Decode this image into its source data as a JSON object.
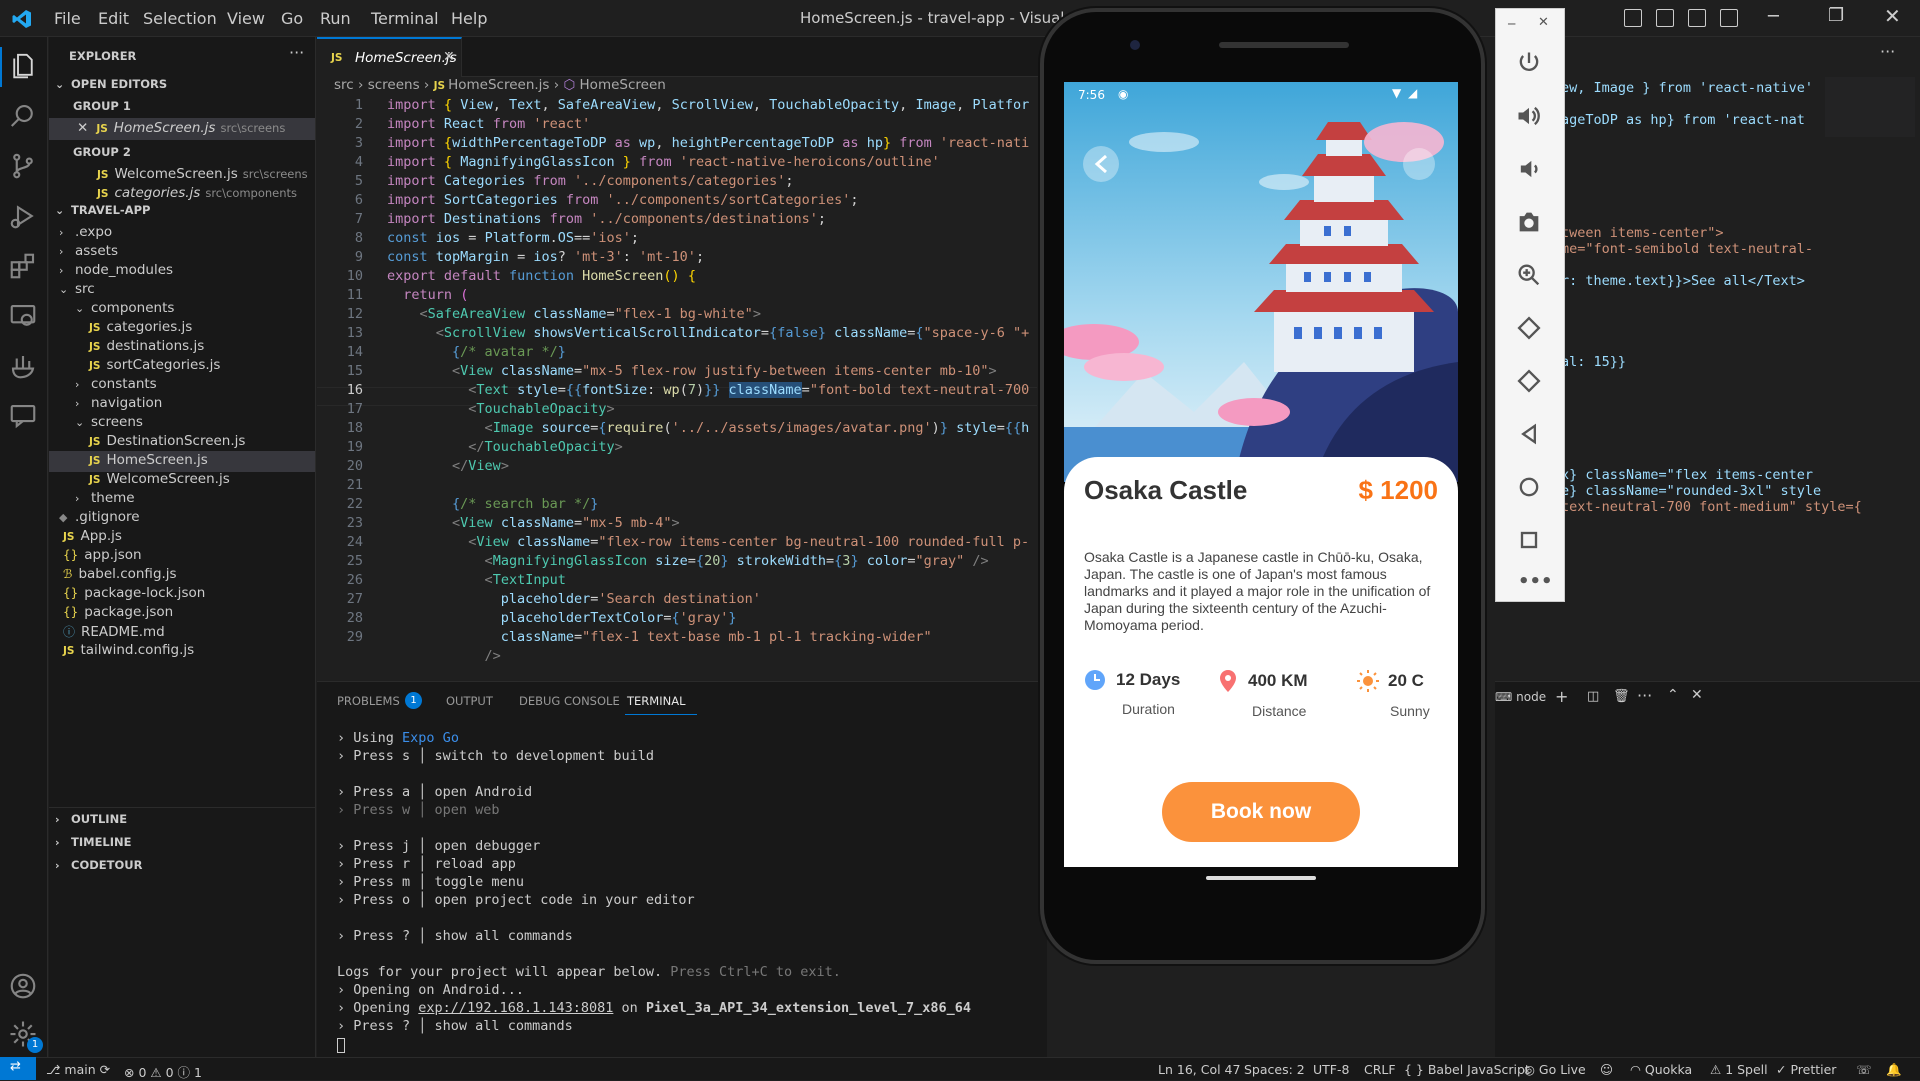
{
  "window": {
    "title": "HomeScreen.js - travel-app - Visual Studi",
    "menu": [
      "File",
      "Edit",
      "Selection",
      "View",
      "Go",
      "Run",
      "Terminal",
      "Help"
    ]
  },
  "sidebar": {
    "header": "EXPLORER",
    "open_editors": "OPEN EDITORS",
    "group1": "GROUP 1",
    "group2": "GROUP 2",
    "open_files": [
      {
        "name": "HomeScreen.js",
        "path": "src\\screens"
      },
      {
        "name": "WelcomeScreen.js",
        "path": "src\\screens"
      },
      {
        "name": "categories.js",
        "path": "src\\components"
      }
    ],
    "project": "TRAVEL-APP",
    "tree": [
      ".expo",
      "assets",
      "node_modules",
      "src",
      "components",
      "categories.js",
      "destinations.js",
      "sortCategories.js",
      "constants",
      "navigation",
      "screens",
      "DestinationScreen.js",
      "HomeScreen.js",
      "WelcomeScreen.js",
      "theme",
      ".gitignore",
      "App.js",
      "app.json",
      "babel.config.js",
      "package-lock.json",
      "package.json",
      "README.md",
      "tailwind.config.js"
    ],
    "outline": "OUTLINE",
    "timeline": "TIMELINE",
    "codetour": "CODETOUR"
  },
  "editor": {
    "tab": "HomeScreen.js",
    "breadcrumb": [
      "src",
      "screens",
      "HomeScreen.js",
      "HomeScreen"
    ],
    "line_numbers": [
      "1",
      "2",
      "3",
      "4",
      "5",
      "6",
      "7",
      "8",
      "9",
      "10",
      "11",
      "12",
      "13",
      "14",
      "15",
      "16",
      "17",
      "18",
      "19",
      "20",
      "21",
      "22",
      "23",
      "24",
      "25",
      "26",
      "27",
      "28",
      "29"
    ],
    "right_fragments": [
      "ew, Image } from 'react-native'",
      "ageToDP as hp} from 'react-nat",
      "tween items-center\">",
      "me=\"font-semibold text-neutral-",
      "r: theme.text}}>See all</Text>",
      "al: 15}}",
      "x} className=\"flex items-center",
      "e} className=\"rounded-3xl\" style",
      "text-neutral-700 font-medium\" style={"
    ]
  },
  "panel": {
    "tabs": [
      "PROBLEMS",
      "OUTPUT",
      "DEBUG CONSOLE",
      "TERMINAL"
    ],
    "problems_count": "1",
    "terminal_name": "node",
    "terminal": {
      "l1a": "Using ",
      "l1b": "Expo Go",
      "l2": "Press s │ switch to development build",
      "l3": "Press a │ open Android",
      "l4": "Press w │ open web",
      "l5": "Press j │ open debugger",
      "l6": "Press r │ reload app",
      "l7": "Press m │ toggle menu",
      "l8": "Press o │ open project code in your editor",
      "l9": "Press ? │ show all commands",
      "l10a": "Logs for your project will appear below. ",
      "l10b": "Press Ctrl+C to exit.",
      "l11": "Opening on Android...",
      "l12a": "Opening ",
      "l12b": "exp://192.168.1.143:8081",
      "l12c": " on ",
      "l12d": "Pixel_3a_API_34_extension_level_7_x86_64",
      "l13": "Press ? │ show all commands"
    }
  },
  "statusbar": {
    "branch": "main",
    "errors": "0",
    "warnings": "0",
    "info": "1",
    "position": "Ln 16, Col 47",
    "spaces": "Spaces: 2",
    "encoding": "UTF-8",
    "eol": "CRLF",
    "language": "Babel JavaScript",
    "golive": "Go Live",
    "quokka": "Quokka",
    "spell": "1 Spell",
    "prettier": "Prettier"
  },
  "phone": {
    "time": "7:56",
    "place": "Osaka Castle",
    "price": "$ 1200",
    "description": "Osaka Castle is a Japanese castle in Chūō-ku, Osaka, Japan. The castle is one of Japan's most famous landmarks and it played a major role in the unification of Japan during the sixteenth century of the Azuchi-Momoyama period.",
    "stats": [
      {
        "value": "12 Days",
        "label": "Duration",
        "icon": "clock-icon",
        "color": "#60a5fa"
      },
      {
        "value": "400 KM",
        "label": "Distance",
        "icon": "map-pin-icon",
        "color": "#f87171"
      },
      {
        "value": "20 C",
        "label": "Sunny",
        "icon": "sun-icon",
        "color": "#fb923c"
      }
    ],
    "button": "Book now",
    "accent": "#f97316"
  }
}
